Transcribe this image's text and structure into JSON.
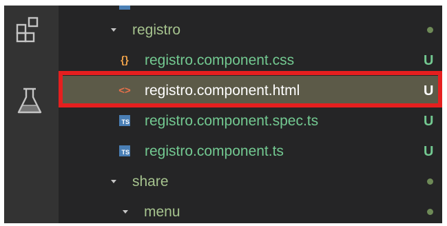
{
  "colors": {
    "activity_bar": "#333333",
    "sidebar": "#252526",
    "selected_row": "#5c5a48",
    "highlight_border": "#e51f1f",
    "untracked_green": "#73c991",
    "folder_text": "#a6c38e",
    "selected_text": "#ffffff",
    "status_dot": "#6e8a57"
  },
  "activity_bar": {
    "icons": [
      "extensions-icon",
      "testing-flask-icon"
    ]
  },
  "explorer": {
    "rows": [
      {
        "type": "folder",
        "label": "registro",
        "expanded": true,
        "status": "dot"
      },
      {
        "type": "file",
        "icon": "css-file-icon",
        "label": "registro.component.css",
        "status": "U"
      },
      {
        "type": "file",
        "icon": "html-file-icon",
        "label": "registro.component.html",
        "status": "U",
        "selected": true
      },
      {
        "type": "file",
        "icon": "ts-file-icon",
        "icon_text": "TS",
        "label": "registro.component.spec.ts",
        "status": "U"
      },
      {
        "type": "file",
        "icon": "ts-file-icon",
        "icon_text": "TS",
        "label": "registro.component.ts",
        "status": "U"
      },
      {
        "type": "folder",
        "label": "share",
        "expanded": true,
        "status": "dot"
      },
      {
        "type": "folder",
        "label": "menu",
        "expanded": true,
        "status": "dot"
      }
    ]
  }
}
